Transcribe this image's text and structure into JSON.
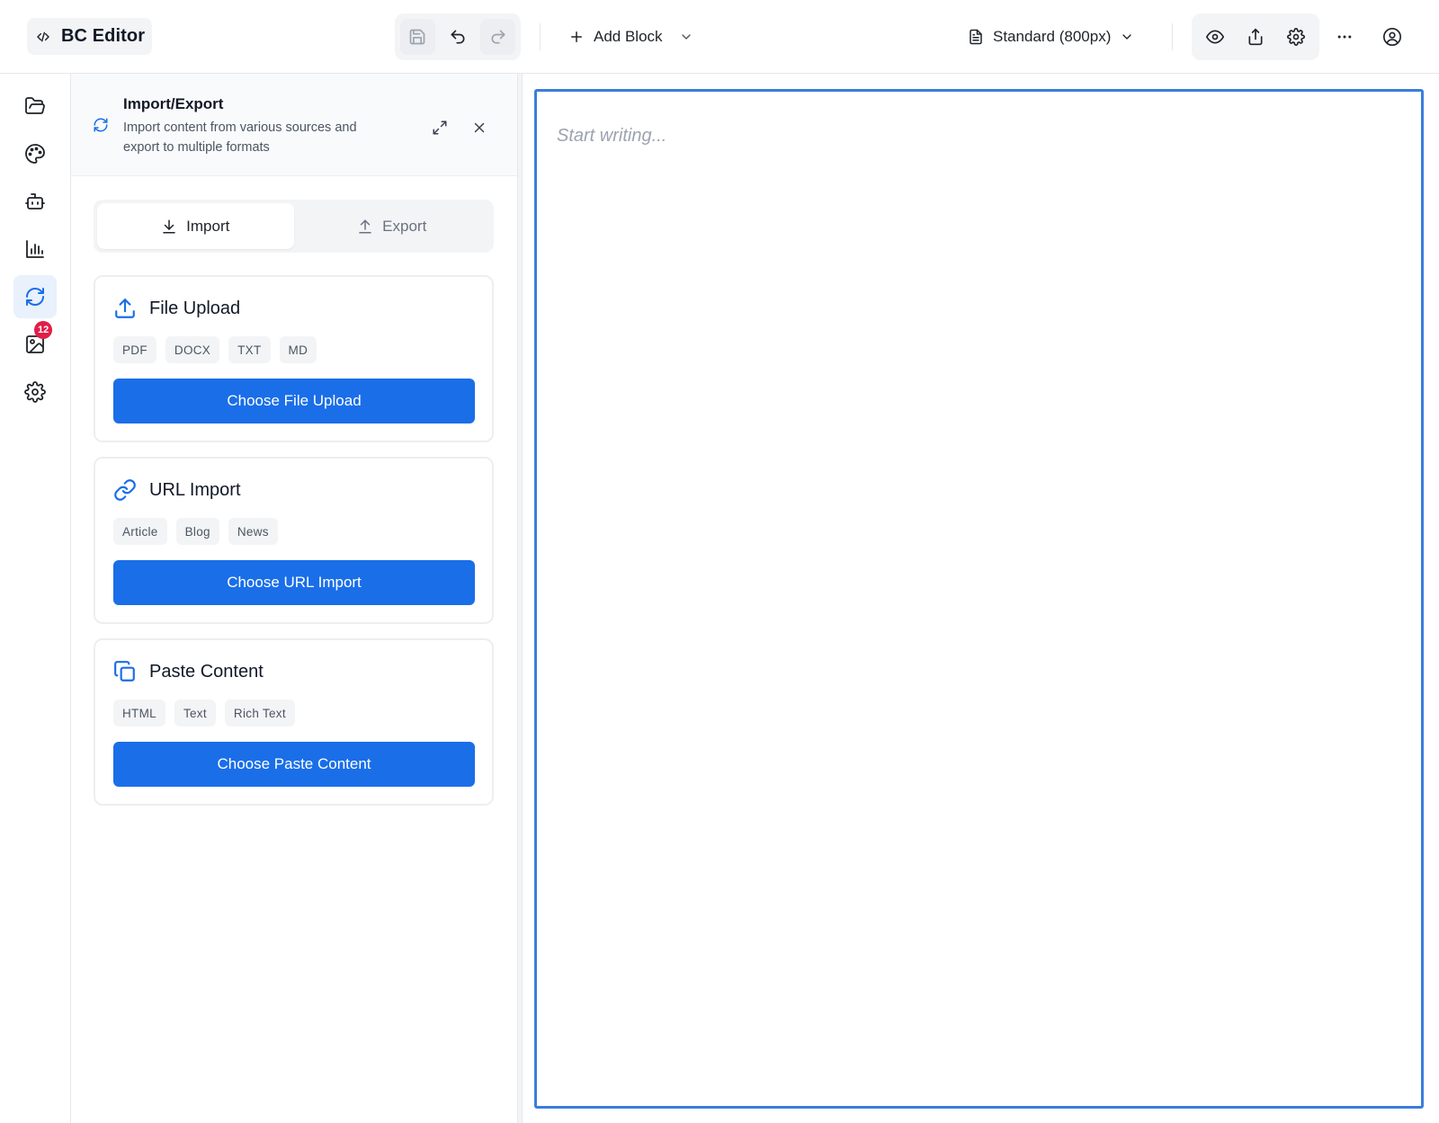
{
  "app": {
    "title": "BC Editor"
  },
  "toolbar": {
    "add_block_label": "Add Block",
    "page_size_label": "Standard (800px)"
  },
  "rail": {
    "items": [
      {
        "icon": "folder-open-icon"
      },
      {
        "icon": "palette-icon"
      },
      {
        "icon": "bot-icon"
      },
      {
        "icon": "bar-chart-icon"
      },
      {
        "icon": "refresh-icon",
        "active": true
      },
      {
        "icon": "image-edit-icon",
        "badge": "12"
      },
      {
        "icon": "gear-icon"
      }
    ]
  },
  "panel": {
    "title": "Import/Export",
    "description": "Import content from various sources and export to multiple formats",
    "tabs": [
      {
        "label": "Import",
        "active": true
      },
      {
        "label": "Export",
        "active": false
      }
    ],
    "cards": [
      {
        "title": "File Upload",
        "icon": "upload-icon",
        "chips": [
          "PDF",
          "DOCX",
          "TXT",
          "MD"
        ],
        "button": "Choose File Upload"
      },
      {
        "title": "URL Import",
        "icon": "link-icon",
        "chips": [
          "Article",
          "Blog",
          "News"
        ],
        "button": "Choose URL Import"
      },
      {
        "title": "Paste Content",
        "icon": "copy-icon",
        "chips": [
          "HTML",
          "Text",
          "Rich Text"
        ],
        "button": "Choose Paste Content"
      }
    ]
  },
  "editor": {
    "placeholder": "Start writing..."
  },
  "colors": {
    "accent": "#1a6ee8",
    "badge": "#e11d48",
    "editor_border": "#3b7ddd"
  }
}
